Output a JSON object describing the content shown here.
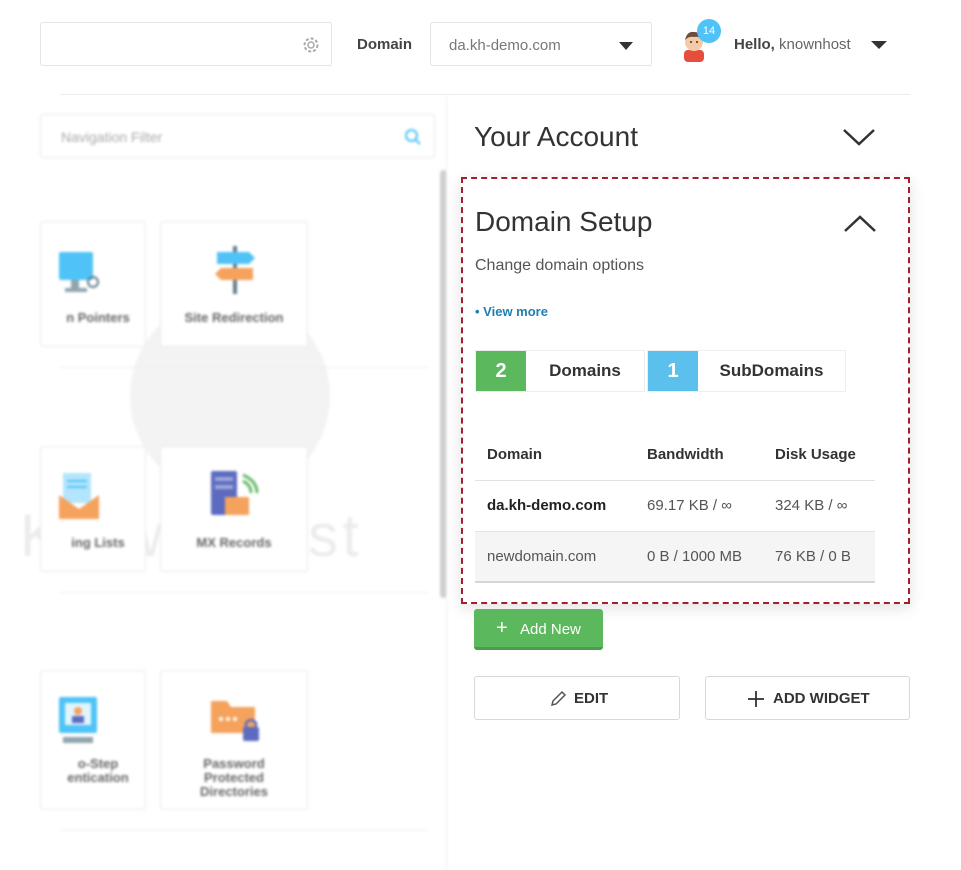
{
  "header": {
    "domain_label": "Domain",
    "domain_value": "da.kh-demo.com",
    "notification_count": "14",
    "hello": "Hello,",
    "username": "knownhost"
  },
  "left_panel": {
    "nav_filter_placeholder": "Navigation Filter",
    "cards": [
      {
        "label": "n Pointers"
      },
      {
        "label": "Site Redirection"
      },
      {
        "label": "ing Lists"
      },
      {
        "label": "MX Records"
      },
      {
        "label_line1": "o-Step",
        "label_line2": "entication"
      },
      {
        "label_line1": "Password",
        "label_line2": "Protected",
        "label_line3": "Directories"
      }
    ],
    "watermark": "KnownHost"
  },
  "your_account": {
    "title": "Your Account"
  },
  "domain_setup": {
    "title": "Domain Setup",
    "subtitle": "Change domain options",
    "view_more": "• View more",
    "stats": [
      {
        "count": "2",
        "label": "Domains",
        "color": "#5cb85c"
      },
      {
        "count": "1",
        "label": "SubDomains",
        "color": "#5bc0eb"
      }
    ],
    "table": {
      "headers": [
        "Domain",
        "Bandwidth",
        "Disk Usage"
      ],
      "rows": [
        [
          "da.kh-demo.com",
          "69.17 KB / ∞",
          "324 KB / ∞"
        ],
        [
          "newdomain.com",
          "0 B / 1000 MB",
          "76 KB / 0 B"
        ]
      ]
    }
  },
  "actions": {
    "add_new": "Add New",
    "edit": "EDIT",
    "add_widget": "ADD WIDGET"
  },
  "colors": {
    "highlight_border": "#a41e2c",
    "green": "#5cb85c",
    "blue": "#5bc0eb",
    "link": "#1e7fb5"
  }
}
